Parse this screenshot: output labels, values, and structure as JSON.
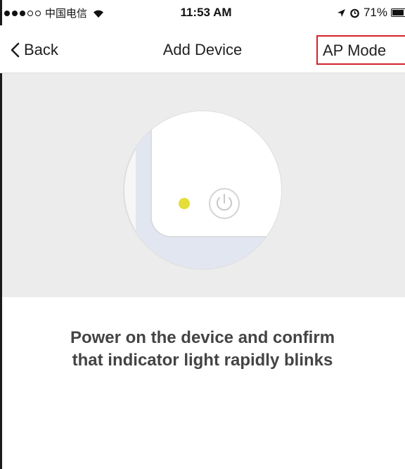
{
  "status_bar": {
    "carrier": "中国电信",
    "time": "11:53 AM",
    "battery": "71%",
    "battery_level": 0.71,
    "signal_bars_filled": 3,
    "signal_bars_total": 5,
    "icons": [
      "signal-dots-icon",
      "wifi-icon",
      "location-arrow-icon",
      "alarm-icon",
      "battery-icon"
    ]
  },
  "nav": {
    "back_label": "Back",
    "title": "Add Device",
    "ap_mode_label": "AP Mode"
  },
  "illustration": {
    "icons": [
      "indicator-light-icon",
      "power-icon"
    ],
    "indicator_color": "#e4de3a",
    "background_color": "#ececec"
  },
  "instruction": {
    "line1": "Power on the device and confirm",
    "line2": "that indicator light rapidly blinks"
  },
  "colors": {
    "highlight_border": "#d2232a"
  }
}
